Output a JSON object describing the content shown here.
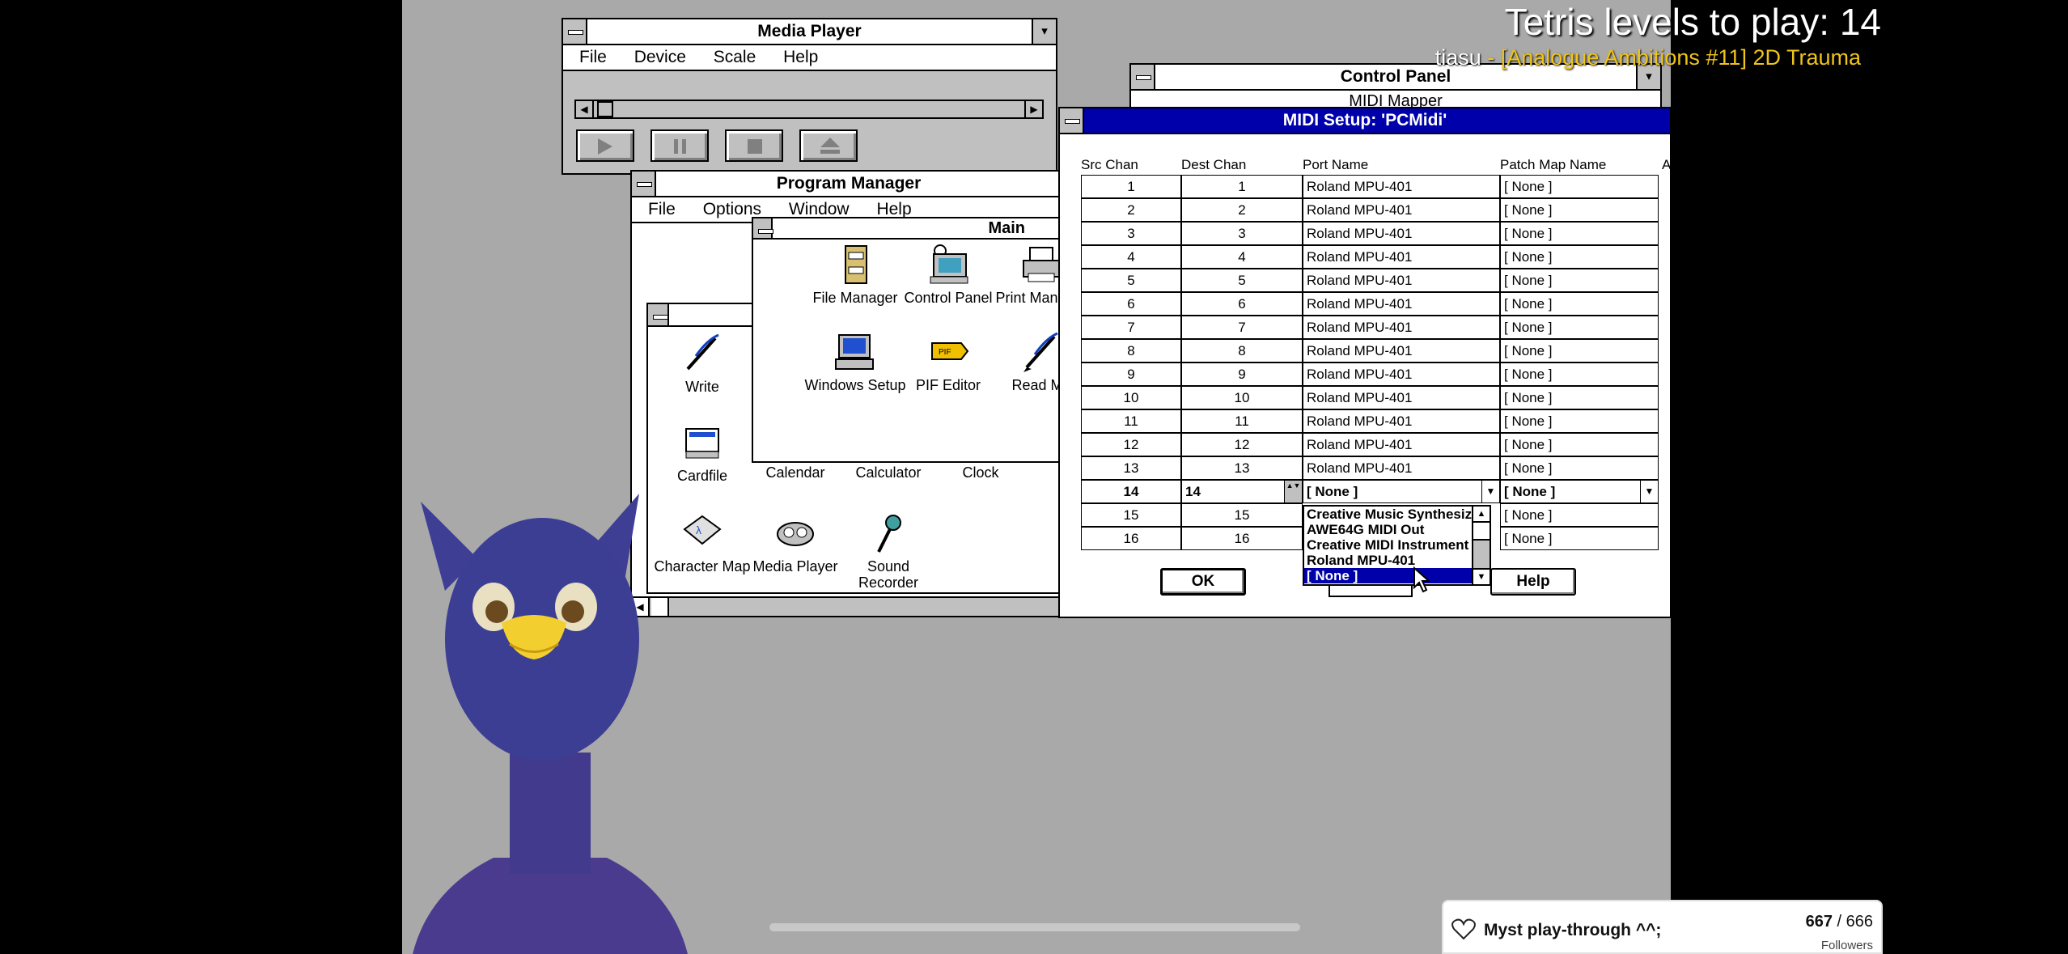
{
  "overlay": {
    "tetris_text": "Tetris levels to play: 14",
    "track_artist": "tiasu",
    "track_rest": " - [Analogue Ambitions #11] 2D Trauma"
  },
  "media_player": {
    "title": "Media Player",
    "menu": [
      "File",
      "Device",
      "Scale",
      "Help"
    ]
  },
  "control_panel": {
    "title": "Control Panel",
    "sub": "MIDI Mapper"
  },
  "program_manager": {
    "title": "Program Manager",
    "menu": [
      "File",
      "Options",
      "Window",
      "Help"
    ],
    "main_group": {
      "title": "Main",
      "icons": [
        "File Manager",
        "Control Panel",
        "Print Manager",
        "Windows Setup",
        "PIF Editor",
        "Read Me"
      ]
    },
    "acc_group": {
      "icons": [
        "Write",
        "Cardfile",
        "Calendar",
        "Calculator",
        "Clock",
        "Character Map",
        "Media Player",
        "Sound Recorder"
      ]
    }
  },
  "midi": {
    "title": "MIDI Setup: 'PCMidi'",
    "headers": [
      "Src Chan",
      "Dest Chan",
      "Port Name",
      "Patch Map Name",
      "Ac"
    ],
    "rows": [
      [
        "1",
        "1",
        "Roland MPU-401",
        "[ None ]"
      ],
      [
        "2",
        "2",
        "Roland MPU-401",
        "[ None ]"
      ],
      [
        "3",
        "3",
        "Roland MPU-401",
        "[ None ]"
      ],
      [
        "4",
        "4",
        "Roland MPU-401",
        "[ None ]"
      ],
      [
        "5",
        "5",
        "Roland MPU-401",
        "[ None ]"
      ],
      [
        "6",
        "6",
        "Roland MPU-401",
        "[ None ]"
      ],
      [
        "7",
        "7",
        "Roland MPU-401",
        "[ None ]"
      ],
      [
        "8",
        "8",
        "Roland MPU-401",
        "[ None ]"
      ],
      [
        "9",
        "9",
        "Roland MPU-401",
        "[ None ]"
      ],
      [
        "10",
        "10",
        "Roland MPU-401",
        "[ None ]"
      ],
      [
        "11",
        "11",
        "Roland MPU-401",
        "[ None ]"
      ],
      [
        "12",
        "12",
        "Roland MPU-401",
        "[ None ]"
      ],
      [
        "13",
        "13",
        "Roland MPU-401",
        "[ None ]"
      ],
      [
        "14",
        "14",
        "[ None ]",
        "[ None ]"
      ],
      [
        "15",
        "15",
        "",
        "[ None ]"
      ],
      [
        "16",
        "16",
        "",
        "[ None ]"
      ]
    ],
    "dropdown_options": [
      "Creative Music Synthesizer",
      "AWE64G MIDI Out",
      "Creative MIDI Instrument",
      "Roland MPU-401",
      "[ None ]"
    ],
    "ok_label": "OK",
    "help_label": "Help"
  },
  "follower": {
    "label": "Myst play-through ^^;",
    "count": "667",
    "goal": "666",
    "sub": "Followers"
  },
  "colors": {
    "title_active": "#0000aa",
    "overlay_yellow": "#f0c419"
  }
}
